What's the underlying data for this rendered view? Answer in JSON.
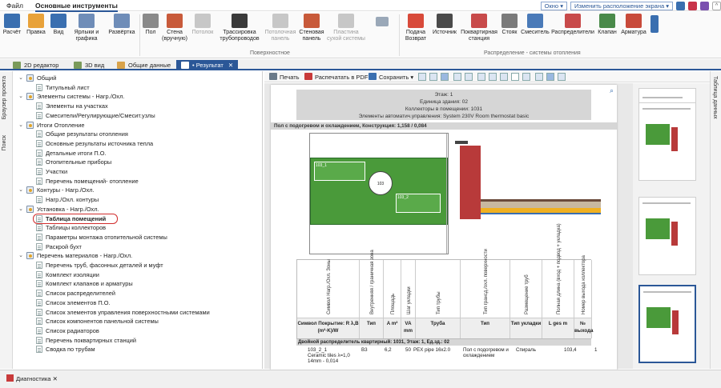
{
  "menu": {
    "file": "Файл",
    "main": "Основные инструменты",
    "window": "Окно",
    "layout": "Изменить расположение экрана"
  },
  "ribbon": {
    "buttons": [
      {
        "label": "Расчёт",
        "color": "#3a6fb0"
      },
      {
        "label": "Правка",
        "color": "#e8a23a"
      },
      {
        "label": "Вид",
        "color": "#3a6fb0"
      },
      {
        "label": "Ярлыки и графика",
        "color": "#6f8db8"
      },
      {
        "label": "Развёртка",
        "color": "#6f8db8"
      },
      {
        "label": "Пол",
        "color": "#8a8a8a"
      },
      {
        "label": "Стена (вручную)",
        "color": "#c85a3a"
      },
      {
        "label": "Потолок",
        "color": "#8a8a8a"
      },
      {
        "label": "Трассировка трубопроводов",
        "color": "#3a3a3a"
      },
      {
        "label": "Потолочная панель",
        "color": "#8a8a8a"
      },
      {
        "label": "Стеновая панель",
        "color": "#c85a3a"
      },
      {
        "label": "Пластина сухой системы",
        "color": "#8a8a8a"
      },
      {
        "label": "Подача Возврат",
        "color": "#d84a3a"
      },
      {
        "label": "Источник",
        "color": "#4a4a4a"
      },
      {
        "label": "Поквартирная станция",
        "color": "#c84a4a"
      },
      {
        "label": "Стояк",
        "color": "#7a7a7a"
      },
      {
        "label": "Смеситель",
        "color": "#4a7ab8"
      },
      {
        "label": "Распределители",
        "color": "#c84a4a"
      },
      {
        "label": "Клапан",
        "color": "#4a8a4a"
      },
      {
        "label": "Арматура",
        "color": "#c84a3a"
      }
    ],
    "group_surface": "Поверхностное",
    "group_distribution": "Распределение - системы отопления"
  },
  "tabs": [
    {
      "label": "2D редактор"
    },
    {
      "label": "3D вид"
    },
    {
      "label": "Общие данные"
    },
    {
      "label": "• Результат"
    }
  ],
  "side": {
    "left_1": "Браузер проекта",
    "left_2": "Поиск",
    "right_1": "Таблица данных"
  },
  "tree": [
    {
      "level": 0,
      "label": "Общий"
    },
    {
      "level": 1,
      "label": "Титульный лист"
    },
    {
      "level": 0,
      "label": "Элементы системы - Нагр./Охл."
    },
    {
      "level": 1,
      "label": "Элементы на участках"
    },
    {
      "level": 1,
      "label": "Смесители/Регулирующие/Смесит.узлы"
    },
    {
      "level": 0,
      "label": "Итоги Отопление"
    },
    {
      "level": 1,
      "label": "Общие результаты отопления"
    },
    {
      "level": 1,
      "label": "Основные результаты источника тепла"
    },
    {
      "level": 1,
      "label": "Детальные итоги П.О."
    },
    {
      "level": 1,
      "label": "Отопительные приборы"
    },
    {
      "level": 1,
      "label": "Участки"
    },
    {
      "level": 1,
      "label": "Перечень помещений- отопление"
    },
    {
      "level": 0,
      "label": "Контуры - Нагр./Охл."
    },
    {
      "level": 1,
      "label": "Нагр./Охл. контуры"
    },
    {
      "level": 0,
      "label": "Установка - Нагр./Охл."
    },
    {
      "level": 1,
      "label": "Таблица помещений",
      "selected": true
    },
    {
      "level": 1,
      "label": "Таблицы коллекторов"
    },
    {
      "level": 1,
      "label": "Параметры монтажа отопительной системы"
    },
    {
      "level": 1,
      "label": "Раскрой бухт"
    },
    {
      "level": 0,
      "label": "Перечень материалов - Нагр./Охл."
    },
    {
      "level": 1,
      "label": "Перечень труб, фасонных деталей и муфт"
    },
    {
      "level": 1,
      "label": "Комплект изоляции"
    },
    {
      "level": 1,
      "label": "Комплект клапанов и арматуры"
    },
    {
      "level": 1,
      "label": "Список распределителей"
    },
    {
      "level": 1,
      "label": "Список элементов П.О."
    },
    {
      "level": 1,
      "label": "Список элементов управления поверхностными системами"
    },
    {
      "level": 1,
      "label": "Список компонентов панельной системы"
    },
    {
      "level": 1,
      "label": "Список радиаторов"
    },
    {
      "level": 1,
      "label": "Перечень поквартирных станций"
    },
    {
      "level": 1,
      "label": "Сводка по трубам"
    }
  ],
  "doc_toolbar": {
    "print": "Печать",
    "pdf": "Распечатать в PDF",
    "save": "Сохранить"
  },
  "page": {
    "floor": "Этаж: 1",
    "building_unit": "Единица здания: 02",
    "manifolds": "Коллекторы в помещении: 1031",
    "automation": "Элементы автоматич.управления: System 230V Room thermostat basic",
    "section": "Пол с подогревом и охлаждением, Конструкция: 1,158 / 0,084",
    "plan_label_1": "103_1",
    "plan_label_2": "103",
    "plan_label_3": "103_2",
    "columns": [
      {
        "vertical": "Символ Нагр./Охл. Зоны",
        "sub": "Символ Покрытие: R λ,B (m²·K)/W"
      },
      {
        "vertical": "Внутренняя / граничная зона",
        "sub": "Тип"
      },
      {
        "vertical": "Площадь",
        "sub": "A m²"
      },
      {
        "vertical": "Шаг укладки",
        "sub": "VA mm"
      },
      {
        "vertical": "Тип трубы",
        "sub": "Труба"
      },
      {
        "vertical": "Тип гранcд./охл. поверхности",
        "sub": "Тип"
      },
      {
        "vertical": "Размещение труб",
        "sub": "Тип укладки"
      },
      {
        "vertical": "Полная длина (вход + подвод + укладка)",
        "sub": "L ges m"
      },
      {
        "vertical": "Номер выхода коллектора",
        "sub": "№ выхода"
      }
    ],
    "group_row": "Двойной распределитель квартирный: 1031, Этаж: 1, Ед.зд.: 02",
    "data_row": {
      "symbol": "103_2_1",
      "covering": "Ceramic tiles λ=1,0",
      "thickness": "14mm - 0,014",
      "type": "B3",
      "area": "6,2",
      "va": "50",
      "pipe": "PEX pipe 16x2.0",
      "surface": "Пол с подогревом и охлаждением",
      "laying": "Спираль",
      "length": "103,4",
      "outlet": "1"
    }
  },
  "status": {
    "diagnostics": "Диагностика"
  }
}
